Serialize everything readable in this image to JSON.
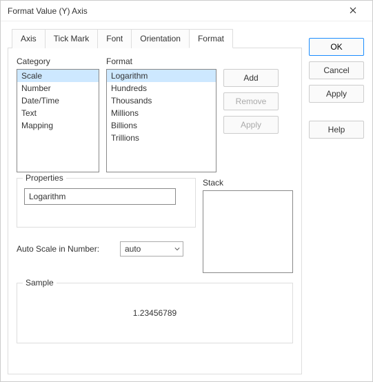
{
  "window": {
    "title": "Format Value (Y) Axis"
  },
  "tabs": {
    "items": [
      {
        "label": "Axis"
      },
      {
        "label": "Tick Mark"
      },
      {
        "label": "Font"
      },
      {
        "label": "Orientation"
      },
      {
        "label": "Format"
      }
    ],
    "active_index": 4
  },
  "category": {
    "label": "Category",
    "items": [
      {
        "label": "Scale",
        "selected": true
      },
      {
        "label": "Number"
      },
      {
        "label": "Date/Time"
      },
      {
        "label": "Text"
      },
      {
        "label": "Mapping"
      }
    ]
  },
  "format": {
    "label": "Format",
    "items": [
      {
        "label": "Logarithm",
        "selected": true
      },
      {
        "label": "Hundreds"
      },
      {
        "label": "Thousands"
      },
      {
        "label": "Millions"
      },
      {
        "label": "Billions"
      },
      {
        "label": "Trillions"
      }
    ]
  },
  "format_action_buttons": {
    "add": "Add",
    "remove": "Remove",
    "apply": "Apply"
  },
  "properties": {
    "legend": "Properties",
    "value": "Logarithm"
  },
  "auto_scale": {
    "label": "Auto Scale in Number:",
    "value": "auto"
  },
  "stack": {
    "label": "Stack"
  },
  "sample": {
    "legend": "Sample",
    "value": "1.23456789"
  },
  "side_buttons": {
    "ok": "OK",
    "cancel": "Cancel",
    "apply": "Apply",
    "help": "Help"
  },
  "icons": {
    "close": "close-icon",
    "dropdown": "chevron-down-icon"
  }
}
